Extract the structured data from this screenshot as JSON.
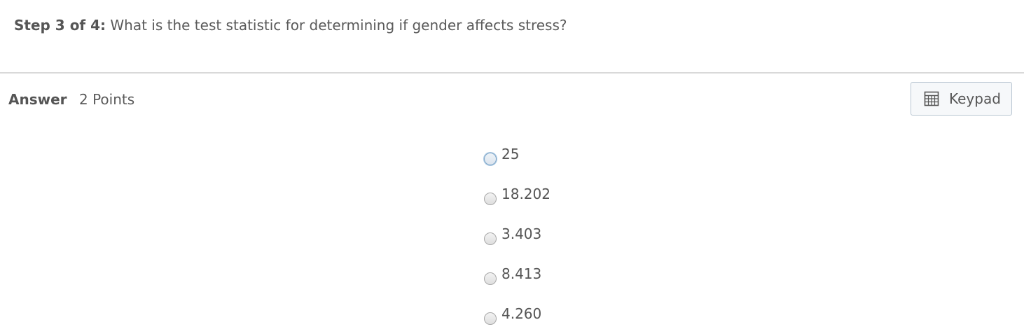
{
  "question": {
    "step_label": "Step 3 of 4:",
    "text": "What is the test statistic for determining if gender affects stress?"
  },
  "answer": {
    "label": "Answer",
    "points": "2 Points"
  },
  "keypad": {
    "label": "Keypad",
    "icon": "calculator-icon"
  },
  "options": [
    {
      "value": "25",
      "selected": false,
      "focused": true
    },
    {
      "value": "18.202",
      "selected": false,
      "focused": false
    },
    {
      "value": "3.403",
      "selected": false,
      "focused": false
    },
    {
      "value": "8.413",
      "selected": false,
      "focused": false
    },
    {
      "value": "4.260",
      "selected": false,
      "focused": false
    }
  ],
  "colors": {
    "text": "#555555",
    "divider": "#d9d9d9",
    "button_border": "#b9c6d2",
    "button_bg": "#f6f8fa",
    "focus_ring": "#a9c7e2"
  }
}
